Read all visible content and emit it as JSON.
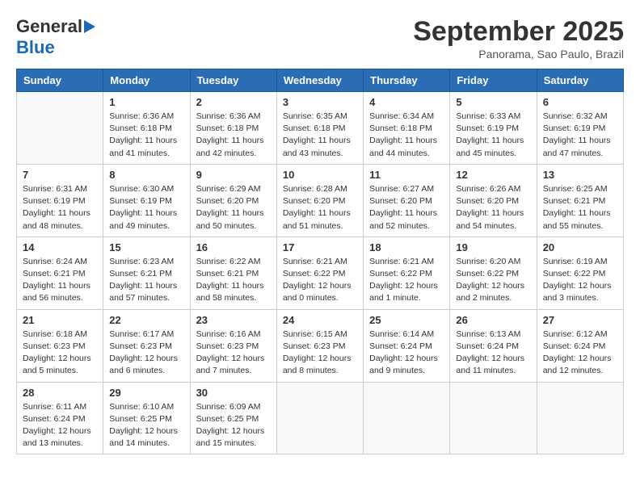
{
  "header": {
    "logo_general": "General",
    "logo_blue": "Blue",
    "month": "September 2025",
    "location": "Panorama, Sao Paulo, Brazil"
  },
  "weekdays": [
    "Sunday",
    "Monday",
    "Tuesday",
    "Wednesday",
    "Thursday",
    "Friday",
    "Saturday"
  ],
  "weeks": [
    [
      {
        "day": "",
        "info": ""
      },
      {
        "day": "1",
        "info": "Sunrise: 6:36 AM\nSunset: 6:18 PM\nDaylight: 11 hours\nand 41 minutes."
      },
      {
        "day": "2",
        "info": "Sunrise: 6:36 AM\nSunset: 6:18 PM\nDaylight: 11 hours\nand 42 minutes."
      },
      {
        "day": "3",
        "info": "Sunrise: 6:35 AM\nSunset: 6:18 PM\nDaylight: 11 hours\nand 43 minutes."
      },
      {
        "day": "4",
        "info": "Sunrise: 6:34 AM\nSunset: 6:18 PM\nDaylight: 11 hours\nand 44 minutes."
      },
      {
        "day": "5",
        "info": "Sunrise: 6:33 AM\nSunset: 6:19 PM\nDaylight: 11 hours\nand 45 minutes."
      },
      {
        "day": "6",
        "info": "Sunrise: 6:32 AM\nSunset: 6:19 PM\nDaylight: 11 hours\nand 47 minutes."
      }
    ],
    [
      {
        "day": "7",
        "info": "Sunrise: 6:31 AM\nSunset: 6:19 PM\nDaylight: 11 hours\nand 48 minutes."
      },
      {
        "day": "8",
        "info": "Sunrise: 6:30 AM\nSunset: 6:19 PM\nDaylight: 11 hours\nand 49 minutes."
      },
      {
        "day": "9",
        "info": "Sunrise: 6:29 AM\nSunset: 6:20 PM\nDaylight: 11 hours\nand 50 minutes."
      },
      {
        "day": "10",
        "info": "Sunrise: 6:28 AM\nSunset: 6:20 PM\nDaylight: 11 hours\nand 51 minutes."
      },
      {
        "day": "11",
        "info": "Sunrise: 6:27 AM\nSunset: 6:20 PM\nDaylight: 11 hours\nand 52 minutes."
      },
      {
        "day": "12",
        "info": "Sunrise: 6:26 AM\nSunset: 6:20 PM\nDaylight: 11 hours\nand 54 minutes."
      },
      {
        "day": "13",
        "info": "Sunrise: 6:25 AM\nSunset: 6:21 PM\nDaylight: 11 hours\nand 55 minutes."
      }
    ],
    [
      {
        "day": "14",
        "info": "Sunrise: 6:24 AM\nSunset: 6:21 PM\nDaylight: 11 hours\nand 56 minutes."
      },
      {
        "day": "15",
        "info": "Sunrise: 6:23 AM\nSunset: 6:21 PM\nDaylight: 11 hours\nand 57 minutes."
      },
      {
        "day": "16",
        "info": "Sunrise: 6:22 AM\nSunset: 6:21 PM\nDaylight: 11 hours\nand 58 minutes."
      },
      {
        "day": "17",
        "info": "Sunrise: 6:21 AM\nSunset: 6:22 PM\nDaylight: 12 hours\nand 0 minutes."
      },
      {
        "day": "18",
        "info": "Sunrise: 6:21 AM\nSunset: 6:22 PM\nDaylight: 12 hours\nand 1 minute."
      },
      {
        "day": "19",
        "info": "Sunrise: 6:20 AM\nSunset: 6:22 PM\nDaylight: 12 hours\nand 2 minutes."
      },
      {
        "day": "20",
        "info": "Sunrise: 6:19 AM\nSunset: 6:22 PM\nDaylight: 12 hours\nand 3 minutes."
      }
    ],
    [
      {
        "day": "21",
        "info": "Sunrise: 6:18 AM\nSunset: 6:23 PM\nDaylight: 12 hours\nand 5 minutes."
      },
      {
        "day": "22",
        "info": "Sunrise: 6:17 AM\nSunset: 6:23 PM\nDaylight: 12 hours\nand 6 minutes."
      },
      {
        "day": "23",
        "info": "Sunrise: 6:16 AM\nSunset: 6:23 PM\nDaylight: 12 hours\nand 7 minutes."
      },
      {
        "day": "24",
        "info": "Sunrise: 6:15 AM\nSunset: 6:23 PM\nDaylight: 12 hours\nand 8 minutes."
      },
      {
        "day": "25",
        "info": "Sunrise: 6:14 AM\nSunset: 6:24 PM\nDaylight: 12 hours\nand 9 minutes."
      },
      {
        "day": "26",
        "info": "Sunrise: 6:13 AM\nSunset: 6:24 PM\nDaylight: 12 hours\nand 11 minutes."
      },
      {
        "day": "27",
        "info": "Sunrise: 6:12 AM\nSunset: 6:24 PM\nDaylight: 12 hours\nand 12 minutes."
      }
    ],
    [
      {
        "day": "28",
        "info": "Sunrise: 6:11 AM\nSunset: 6:24 PM\nDaylight: 12 hours\nand 13 minutes."
      },
      {
        "day": "29",
        "info": "Sunrise: 6:10 AM\nSunset: 6:25 PM\nDaylight: 12 hours\nand 14 minutes."
      },
      {
        "day": "30",
        "info": "Sunrise: 6:09 AM\nSunset: 6:25 PM\nDaylight: 12 hours\nand 15 minutes."
      },
      {
        "day": "",
        "info": ""
      },
      {
        "day": "",
        "info": ""
      },
      {
        "day": "",
        "info": ""
      },
      {
        "day": "",
        "info": ""
      }
    ]
  ]
}
